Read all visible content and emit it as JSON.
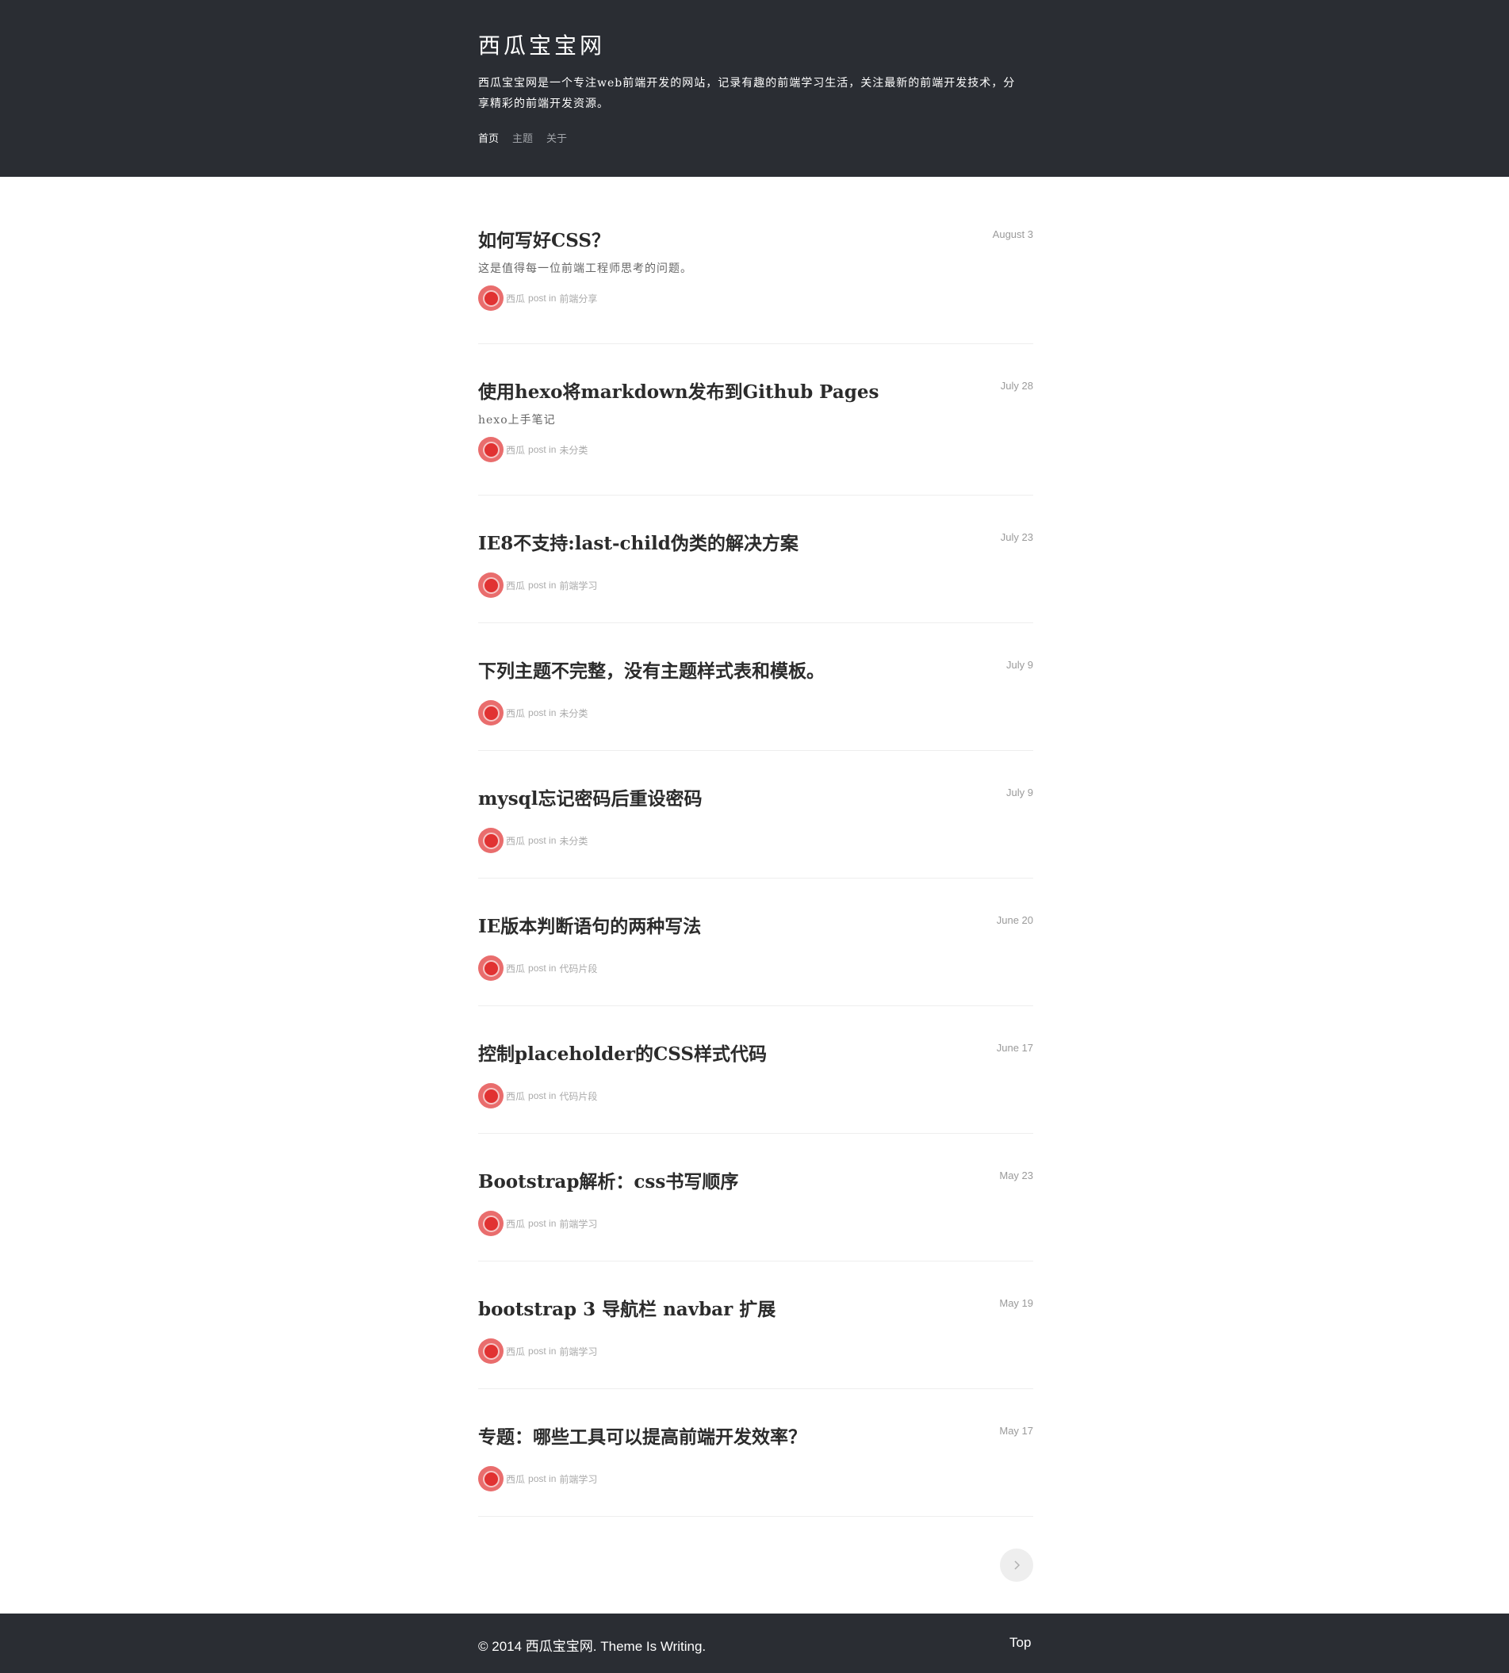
{
  "site": {
    "title": "西瓜宝宝网",
    "description": "西瓜宝宝网是一个专注web前端开发的网站，记录有趣的前端学习生活，关注最新的前端开发技术，分享精彩的前端开发资源。"
  },
  "nav": {
    "items": [
      "首页",
      "主题",
      "关于"
    ],
    "active": "首页"
  },
  "posts": [
    {
      "title": "如何写好CSS？",
      "date": "August 3",
      "excerpt": "这是值得每一位前端工程师思考的问题。",
      "author": "西瓜",
      "meta_mid": "post in",
      "category": "前端分享"
    },
    {
      "title": "使用hexo将markdown发布到Github Pages",
      "date": "July 28",
      "excerpt": "hexo上手笔记",
      "author": "西瓜",
      "meta_mid": "post in",
      "category": "未分类"
    },
    {
      "title": "IE8不支持:last-child伪类的解决方案",
      "date": "July 23",
      "excerpt": "",
      "author": "西瓜",
      "meta_mid": "post in",
      "category": "前端学习"
    },
    {
      "title": "下列主题不完整，没有主题样式表和模板。",
      "date": "July 9",
      "excerpt": "",
      "author": "西瓜",
      "meta_mid": "post in",
      "category": "未分类"
    },
    {
      "title": "mysql忘记密码后重设密码",
      "date": "July 9",
      "excerpt": "",
      "author": "西瓜",
      "meta_mid": "post in",
      "category": "未分类"
    },
    {
      "title": "IE版本判断语句的两种写法",
      "date": "June 20",
      "excerpt": "",
      "author": "西瓜",
      "meta_mid": "post in",
      "category": "代码片段"
    },
    {
      "title": "控制placeholder的CSS样式代码",
      "date": "June 17",
      "excerpt": "",
      "author": "西瓜",
      "meta_mid": "post in",
      "category": "代码片段"
    },
    {
      "title": "Bootstrap解析：css书写顺序",
      "date": "May 23",
      "excerpt": "",
      "author": "西瓜",
      "meta_mid": "post in",
      "category": "前端学习"
    },
    {
      "title": "bootstrap 3 导航栏 navbar 扩展",
      "date": "May 19",
      "excerpt": "",
      "author": "西瓜",
      "meta_mid": "post in",
      "category": "前端学习"
    },
    {
      "title": "专题：哪些工具可以提高前端开发效率？",
      "date": "May 17",
      "excerpt": "",
      "author": "西瓜",
      "meta_mid": "post in",
      "category": "前端学习"
    }
  ],
  "pagination": {
    "next_icon": "chevron-right-icon"
  },
  "footer": {
    "copyright": "© 2014 西瓜宝宝网. Theme Is Writing.",
    "top_label": "Top"
  },
  "colors": {
    "header_bg": "#2a2d33",
    "avatar": "#e13232"
  }
}
